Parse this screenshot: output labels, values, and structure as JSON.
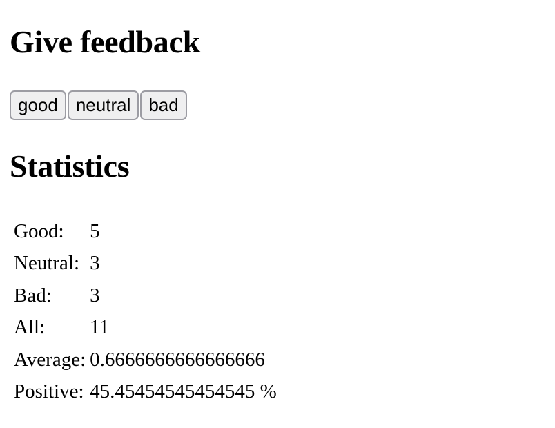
{
  "feedback": {
    "title": "Give feedback",
    "buttons": {
      "good": "good",
      "neutral": "neutral",
      "bad": "bad"
    }
  },
  "statistics": {
    "title": "Statistics",
    "rows": [
      {
        "label": "Good:",
        "value": "5"
      },
      {
        "label": "Neutral:",
        "value": "3"
      },
      {
        "label": "Bad:",
        "value": "3"
      },
      {
        "label": "All:",
        "value": "11"
      },
      {
        "label": "Average:",
        "value": "0.6666666666666666"
      },
      {
        "label": "Positive:",
        "value": "45.45454545454545 %"
      }
    ]
  }
}
